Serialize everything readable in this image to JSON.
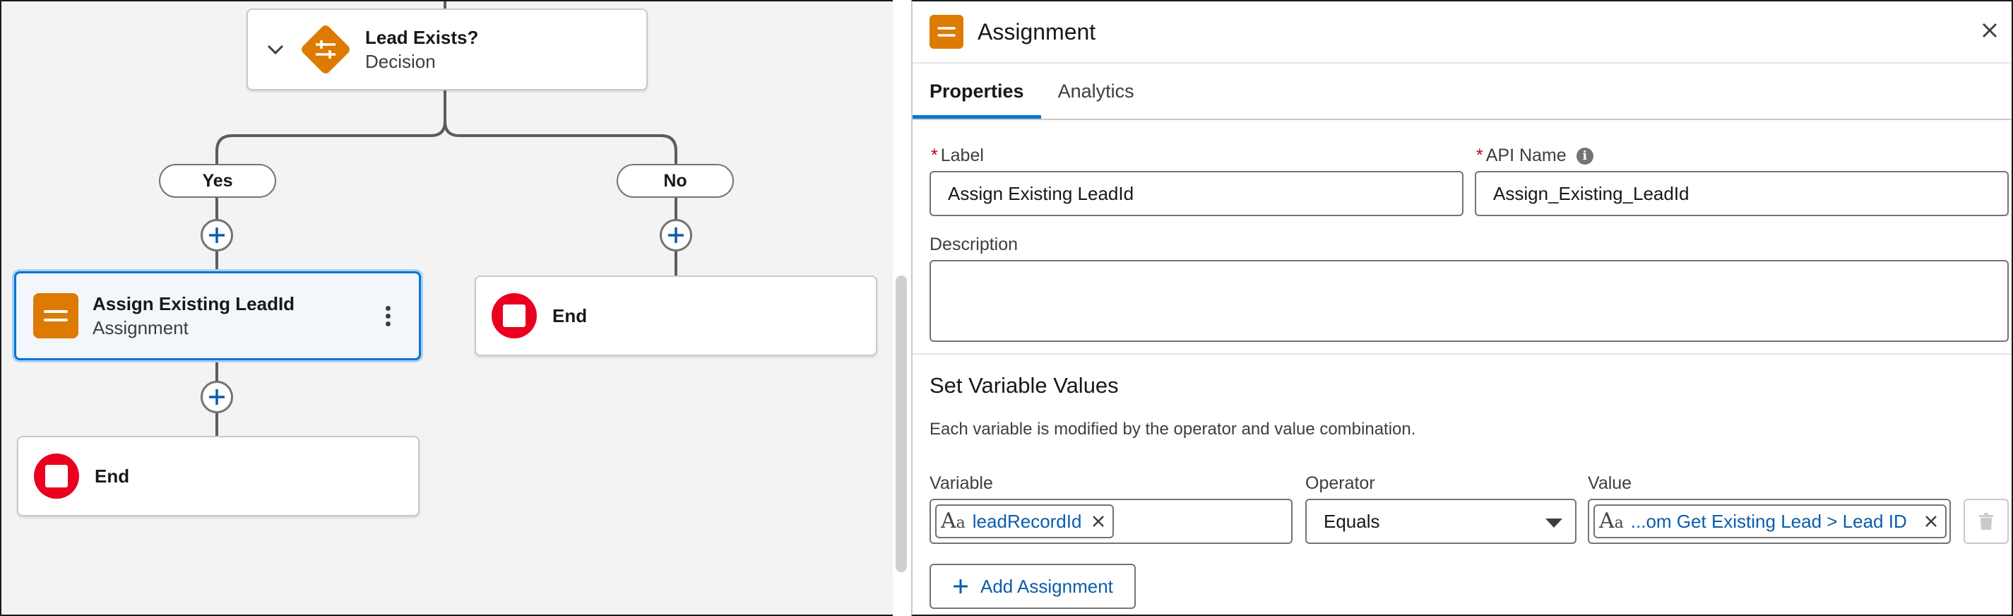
{
  "canvas": {
    "decision": {
      "title": "Lead Exists?",
      "type": "Decision"
    },
    "outcomes": {
      "yes": "Yes",
      "no": "No"
    },
    "assignment_node": {
      "title": "Assign Existing LeadId",
      "type": "Assignment"
    },
    "end_label": "End"
  },
  "panel": {
    "title": "Assignment",
    "tabs": [
      "Properties",
      "Analytics"
    ],
    "label_field": {
      "label": "Label",
      "value": "Assign Existing LeadId"
    },
    "api_field": {
      "label": "API Name",
      "value": "Assign_Existing_LeadId"
    },
    "description": {
      "label": "Description",
      "value": ""
    },
    "set_values": {
      "title": "Set Variable Values",
      "desc": "Each variable is modified by the operator and value combination.",
      "col_variable": "Variable",
      "col_operator": "Operator",
      "col_value": "Value",
      "row": {
        "variable": "leadRecordId",
        "operator": "Equals",
        "value": "...om Get Existing Lead > Lead ID"
      }
    },
    "add_assignment": "Add Assignment"
  },
  "colors": {
    "assignment_orange": "#dd7a01",
    "end_red": "#ea001e",
    "brand_blue": "#0176d3",
    "link_blue": "#0b5cab",
    "required_red": "#ba0517"
  }
}
